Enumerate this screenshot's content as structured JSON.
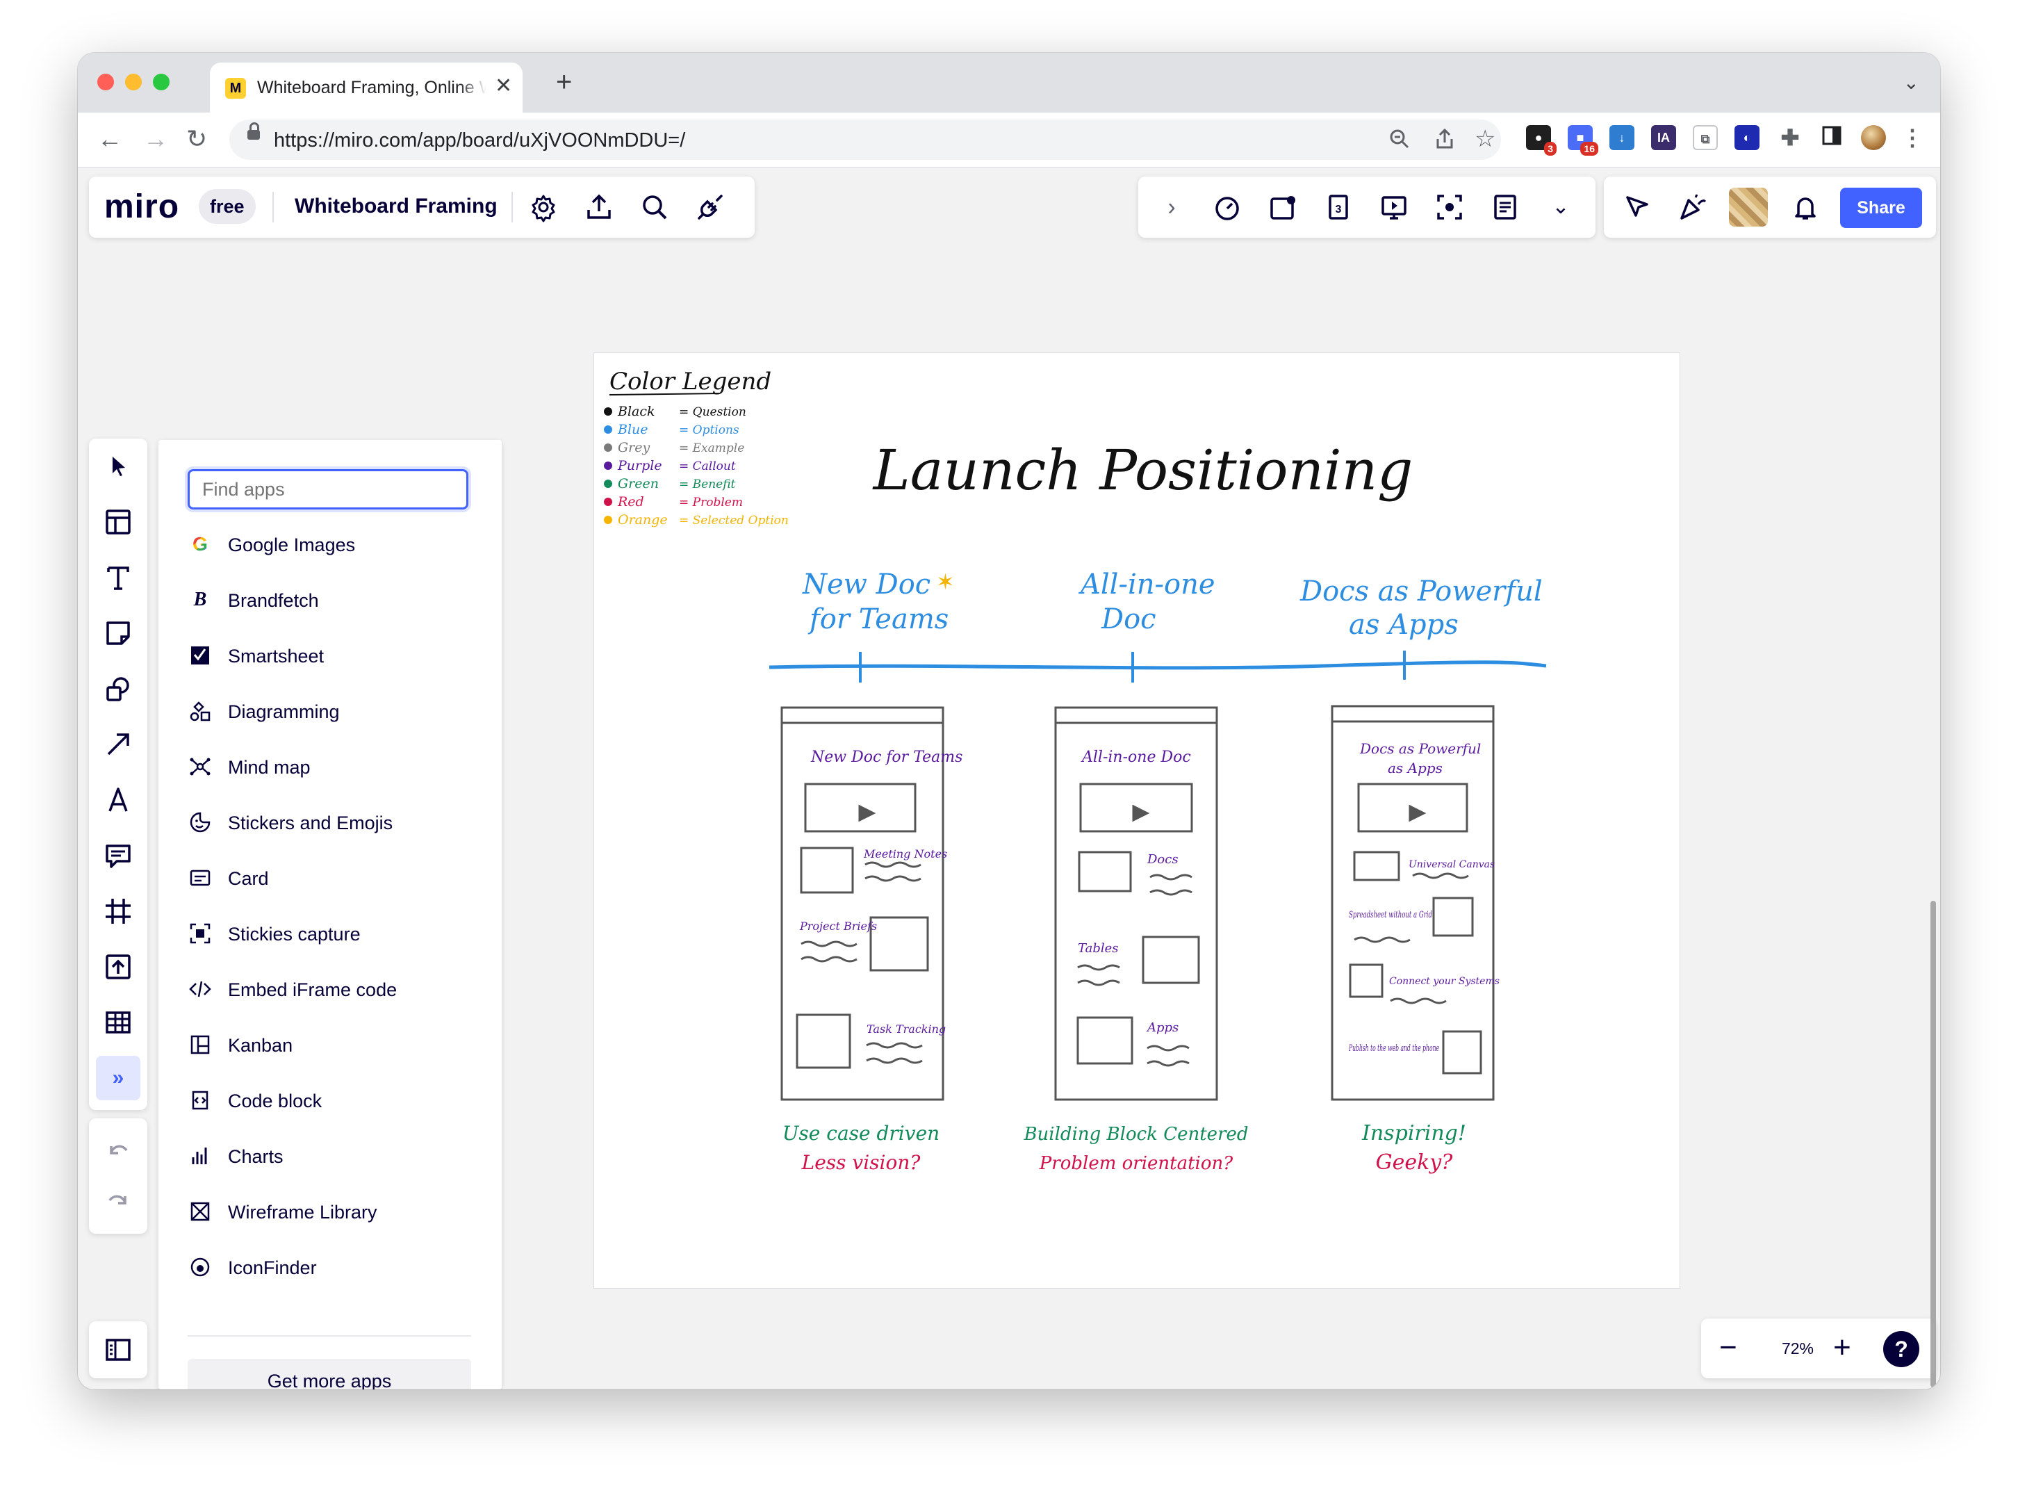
{
  "browser": {
    "tab_title": "Whiteboard Framing, Online Whiteboard for Visual Collaboration",
    "tab_favicon": "M",
    "url": "https://miro.com/app/board/uXjVOONmDDU=/",
    "extensions": [
      {
        "name": "extension-1-icon",
        "badge": "3",
        "color": "#1f1f1f"
      },
      {
        "name": "extension-2-icon",
        "badge": "16",
        "color": "#4a6cf7"
      },
      {
        "name": "download-extension-icon",
        "badge": "",
        "color": "#2e7dd1"
      },
      {
        "name": "ia-extension-icon",
        "label": "IA",
        "badge": "",
        "color": "#3b2d6b"
      },
      {
        "name": "copy-extension-icon",
        "badge": "",
        "color": "#ffffff"
      },
      {
        "name": "dark-extension-icon",
        "badge": "",
        "color": "#1e2bb0"
      }
    ]
  },
  "miro": {
    "logo": "miro",
    "plan_badge": "free",
    "board_name": "Whiteboard Framing",
    "share_label": "Share",
    "zoom": "72%",
    "help_label": "?"
  },
  "apps_panel": {
    "search_placeholder": "Find apps",
    "items": [
      {
        "label": "Google Images",
        "icon": "google-icon"
      },
      {
        "label": "Brandfetch",
        "icon": "brandfetch-icon"
      },
      {
        "label": "Smartsheet",
        "icon": "smartsheet-icon"
      },
      {
        "label": "Diagramming",
        "icon": "diagramming-icon"
      },
      {
        "label": "Mind map",
        "icon": "mind-map-icon"
      },
      {
        "label": "Stickers and Emojis",
        "icon": "sticker-icon"
      },
      {
        "label": "Card",
        "icon": "card-icon"
      },
      {
        "label": "Stickies capture",
        "icon": "stickies-capture-icon"
      },
      {
        "label": "Embed iFrame code",
        "icon": "code-icon"
      },
      {
        "label": "Kanban",
        "icon": "kanban-icon"
      },
      {
        "label": "Code block",
        "icon": "code-block-icon"
      },
      {
        "label": "Charts",
        "icon": "charts-icon"
      },
      {
        "label": "Wireframe Library",
        "icon": "wireframe-icon"
      },
      {
        "label": "IconFinder",
        "icon": "iconfinder-icon"
      }
    ],
    "get_more": "Get more apps"
  },
  "board": {
    "legend_title": "Color Legend",
    "legend": [
      {
        "name": "Black",
        "meaning": "Question",
        "color": "#111111"
      },
      {
        "name": "Blue",
        "meaning": "Options",
        "color": "#2d8de0"
      },
      {
        "name": "Grey",
        "meaning": "Example",
        "color": "#7a7a7a"
      },
      {
        "name": "Purple",
        "meaning": "Callout",
        "color": "#5a1a9e"
      },
      {
        "name": "Green",
        "meaning": "Benefit",
        "color": "#138a5a"
      },
      {
        "name": "Red",
        "meaning": "Problem",
        "color": "#d0124a"
      },
      {
        "name": "Orange",
        "meaning": "Selected Option",
        "color": "#f5b400"
      }
    ],
    "title": "Launch Positioning",
    "options": [
      {
        "heading": [
          "New Doc",
          "for Teams"
        ],
        "page_title": [
          "New Doc for Teams"
        ],
        "blocks": [
          {
            "label": "Meeting Notes"
          },
          {
            "label": "Project Briefs"
          },
          {
            "label": "Task Tracking"
          }
        ],
        "notes": [
          {
            "text": "Use case driven",
            "color": "#138a5a"
          },
          {
            "text": "Less vision?",
            "color": "#d0124a"
          }
        ]
      },
      {
        "heading": [
          "All-in-one",
          "Doc"
        ],
        "page_title": [
          "All-in-one Doc"
        ],
        "blocks": [
          {
            "label": "Docs"
          },
          {
            "label": "Tables"
          },
          {
            "label": "Apps"
          }
        ],
        "notes": [
          {
            "text": "Building Block Centered",
            "color": "#138a5a"
          },
          {
            "text": "Problem orientation?",
            "color": "#d0124a"
          }
        ]
      },
      {
        "heading": [
          "Docs as Powerful",
          "as Apps"
        ],
        "page_title": [
          "Docs as Powerful",
          "as Apps"
        ],
        "blocks": [
          {
            "label": "Universal Canvas"
          },
          {
            "label": "Spreadsheet without a Grid"
          },
          {
            "label": "Connect your Systems"
          },
          {
            "label": "Publish to the web and the phone"
          }
        ],
        "notes": [
          {
            "text": "Inspiring!",
            "color": "#138a5a"
          },
          {
            "text": "Geeky?",
            "color": "#d0124a"
          }
        ]
      }
    ]
  }
}
